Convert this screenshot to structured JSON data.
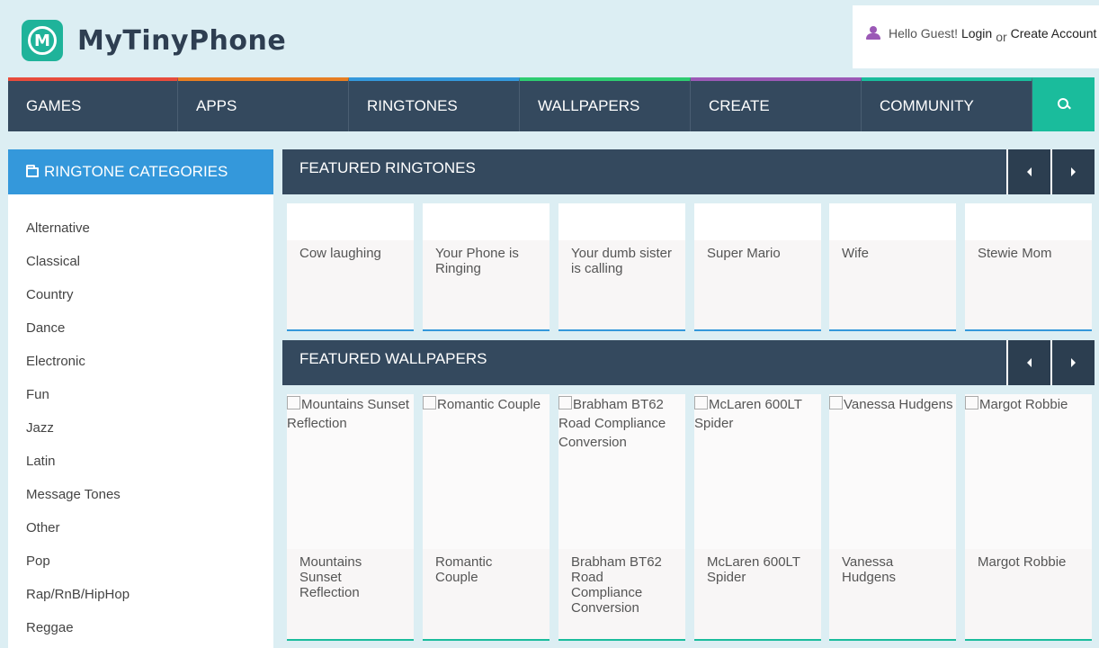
{
  "header": {
    "logo_letter": "M",
    "logo_text": "MyTinyPhone",
    "greeting": "Hello Guest!",
    "login": "Login",
    "or": "or",
    "create_account": "Create Account"
  },
  "nav": {
    "items": [
      "GAMES",
      "APPS",
      "RINGTONES",
      "WALLPAPERS",
      "CREATE",
      "COMMUNITY"
    ]
  },
  "sidebar": {
    "title": "RINGTONE CATEGORIES",
    "items": [
      "Alternative",
      "Classical",
      "Country",
      "Dance",
      "Electronic",
      "Fun",
      "Jazz",
      "Latin",
      "Message Tones",
      "Other",
      "Pop",
      "Rap/RnB/HipHop",
      "Reggae"
    ]
  },
  "ringtones": {
    "title": "FEATURED RINGTONES",
    "items": [
      "Cow laughing",
      "Your Phone is Ringing",
      "Your dumb sister is calling",
      "Super Mario",
      "Wife",
      "Stewie Mom"
    ]
  },
  "wallpapers": {
    "title": "FEATURED WALLPAPERS",
    "items": [
      "Mountains Sunset Reflection",
      "Romantic Couple",
      "Brabham BT62 Road Compliance Conversion",
      "McLaren 600LT Spider",
      "Vanessa Hudgens",
      "Margot Robbie"
    ]
  },
  "colors": {
    "brand": "#1fb39a",
    "nav_bg": "#34495e",
    "accent_blue": "#3498db",
    "user_icon": "#9b59b6"
  }
}
